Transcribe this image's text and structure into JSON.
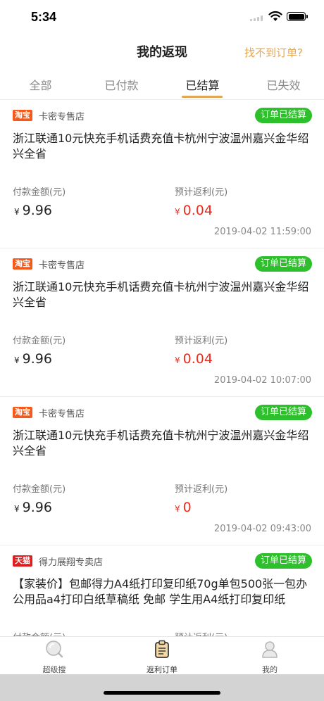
{
  "status_bar": {
    "time": "5:34"
  },
  "nav": {
    "title": "我的返现",
    "right_link": "找不到订单?"
  },
  "tabs": [
    {
      "label": "全部"
    },
    {
      "label": "已付款"
    },
    {
      "label": "已结算"
    },
    {
      "label": "已失效"
    }
  ],
  "labels": {
    "pay": "付款金额(元)",
    "rebate": "预计返利(元)",
    "currency": "¥"
  },
  "orders": [
    {
      "platform": "淘宝",
      "shop": "卡密专售店",
      "status": "订单已结算",
      "title": "浙江联通10元快充手机话费充值卡杭州宁波温州嘉兴金华绍兴全省",
      "pay_amount": "9.96",
      "rebate": "0.04",
      "time": "2019-04-02 11:59:00"
    },
    {
      "platform": "淘宝",
      "shop": "卡密专售店",
      "status": "订单已结算",
      "title": "浙江联通10元快充手机话费充值卡杭州宁波温州嘉兴金华绍兴全省",
      "pay_amount": "9.96",
      "rebate": "0.04",
      "time": "2019-04-02 10:07:00"
    },
    {
      "platform": "淘宝",
      "shop": "卡密专售店",
      "status": "订单已结算",
      "title": "浙江联通10元快充手机话费充值卡杭州宁波温州嘉兴金华绍兴全省",
      "pay_amount": "9.96",
      "rebate": "0",
      "time": "2019-04-02 09:43:00"
    },
    {
      "platform": "天猫",
      "shop": "得力展翔专卖店",
      "status": "订单已结算",
      "title": "【家装价】包邮得力A4纸打印复印纸70g单包500张一包办公用品a4打印白纸草稿纸 免邮 学生用A4纸打印复印纸",
      "pay_amount": "",
      "rebate": "",
      "time": ""
    }
  ],
  "tabbar": [
    {
      "label": "超级搜",
      "icon": "search-icon"
    },
    {
      "label": "返利订单",
      "icon": "clipboard-icon"
    },
    {
      "label": "我的",
      "icon": "profile-icon"
    }
  ],
  "colors": {
    "accent": "#e2a654",
    "status_green": "#2ec02c",
    "rebate_red": "#f22a1c",
    "taobao": "#f45a1c",
    "tmall": "#de1f1f"
  }
}
